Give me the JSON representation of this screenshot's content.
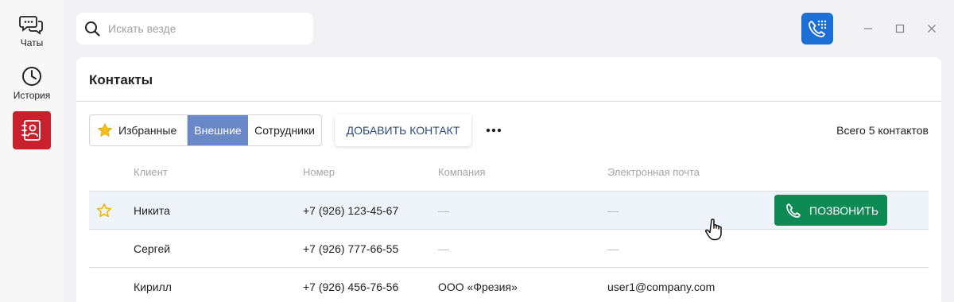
{
  "sidebar": {
    "items": [
      {
        "label": "Чаты",
        "icon": "chat-icon"
      },
      {
        "label": "История",
        "icon": "history-clock-icon"
      },
      {
        "label": "",
        "icon": "contacts-book-icon",
        "active": true
      }
    ]
  },
  "search": {
    "placeholder": "Искать везде",
    "value": ""
  },
  "colors": {
    "accent_blue": "#1d6fd6",
    "active_red": "#c8202c",
    "segment_active": "#6b88c6",
    "call_green": "#0e8a55",
    "row_highlight": "#eef4f9"
  },
  "contacts": {
    "title": "Контакты",
    "filters": [
      {
        "label": "Избранные",
        "icon": "star-icon",
        "active": false
      },
      {
        "label": "Внешние",
        "active": true
      },
      {
        "label": "Сотрудники",
        "active": false
      }
    ],
    "add_button": "ДОБАВИТЬ КОНТАКТ",
    "total": "Всего 5 контактов",
    "columns": [
      "Клиент",
      "Номер",
      "Компания",
      "Электронная почта"
    ],
    "rows": [
      {
        "name": "Никита",
        "phone": "+7 (926) 123-45-67",
        "company": "—",
        "email": "—",
        "favorite": true,
        "hovered": true
      },
      {
        "name": "Сергей",
        "phone": "+7 (926) 777-66-55",
        "company": "—",
        "email": "—",
        "favorite": false
      },
      {
        "name": "Кирилл",
        "phone": "+7 (926) 456-76-56",
        "company": "ООО «Фрезия»",
        "email": "user1@company.com",
        "favorite": false
      }
    ],
    "call_button": "ПОЗВОНИТЬ"
  }
}
